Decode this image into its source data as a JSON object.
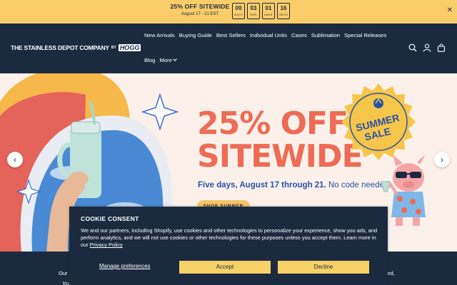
{
  "announcement": {
    "title": "25% OFF SITEWIDE",
    "dates": "August 17 - 21 EST",
    "countdown": [
      {
        "value": "00",
        "label": "DAYS"
      },
      {
        "value": "03",
        "label": "HRS"
      },
      {
        "value": "01",
        "label": "MINS"
      },
      {
        "value": "16",
        "label": "SECS"
      }
    ],
    "close_icon": "close-icon",
    "close_glyph": "✕"
  },
  "header": {
    "logo_text": "THE STAINLESS DEPOT COMPANY",
    "logo_by": "BY",
    "logo_brand": "HOGG",
    "nav_row1": [
      "New Arrivals",
      "Buying Guide",
      "Best Sellers",
      "Individual Units",
      "Cases",
      "Sublimation",
      "Special Releases"
    ],
    "nav_row2": [
      "Blog",
      "More"
    ],
    "icons": [
      "search-icon",
      "account-icon",
      "cart-icon"
    ]
  },
  "hero": {
    "headline_line1": "25% OFF",
    "headline_line2": "SITEWIDE",
    "sub_bold": "Five days, August 17 through 21.",
    "sub_regular": " No code needed.",
    "cta": "SHOP SUMMER",
    "badge_line1": "SUMMER",
    "badge_line2": "SALE",
    "arrow_prev": "‹",
    "arrow_next": "›",
    "colors": {
      "headline": "#ee6b55",
      "sub": "#2854a6",
      "badge": "#f6c64a"
    }
  },
  "below": {
    "left_text": "Our",
    "left_text2": "tru",
    "right_text": "red,"
  },
  "cookie": {
    "title": "COOKIE CONSENT",
    "body": "We and our partners, including Shopify, use cookies and other technologies to personalize your experience, show you ads, and perform analytics, and we will not use cookies or other technologies for these purposes unless you accept them. Learn more in our ",
    "link": "Privacy Policy",
    "manage": "Manage preferences",
    "accept": "Accept",
    "decline": "Decline"
  },
  "colors": {
    "navy": "#1c2a3f",
    "announce_bg": "#f9cd6a",
    "hero_bg": "#fbf1ea",
    "button_yellow": "#f6d267"
  }
}
